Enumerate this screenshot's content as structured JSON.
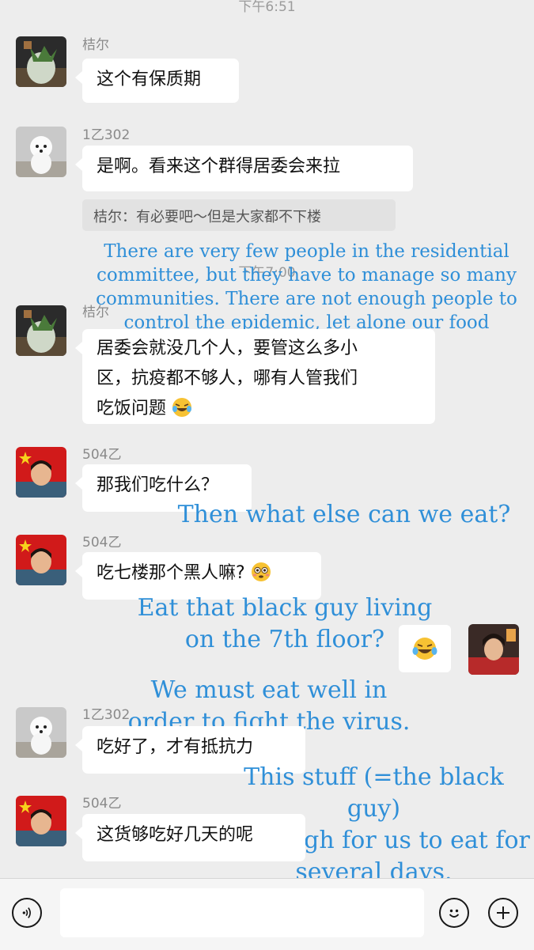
{
  "times": {
    "t1": "下午6:51",
    "t2": "下午7:00"
  },
  "messages": {
    "m1": {
      "sender": "桔尔",
      "text": "这个有保质期"
    },
    "m2": {
      "sender": "1乙302",
      "text": "是啊。看来这个群得居委会来拉",
      "quote": "桔尔：有必要吧～但是大家都不下楼"
    },
    "m3": {
      "sender": "桔尔",
      "line1": "居委会就没几个人，要管这么多小",
      "line2": "区，抗疫都不够人，哪有人管我们",
      "line3": "吃饭问题"
    },
    "m4": {
      "sender": "504乙",
      "text": "那我们吃什么？"
    },
    "m5": {
      "sender": "504乙",
      "text": "吃七楼那个黑人嘛?"
    },
    "m6": {
      "sender": "1乙302",
      "text": "吃好了，才有抵抗力"
    },
    "m7": {
      "sender": "504乙",
      "text": "这货够吃好几天的呢"
    }
  },
  "annotations": {
    "a1": {
      "line1": "There are very few people in the residential",
      "line2": "committee, but they have to manage so many",
      "line3": "communities. There are not enough people to",
      "line4": "control the epidemic, let alone our food problems."
    },
    "a2": "Then what else can we eat?",
    "a3": {
      "line1": "Eat that black guy living",
      "line2": "on the 7th floor?"
    },
    "a4": {
      "line1": "We must eat well in",
      "line2": "order to fight the virus."
    },
    "a5": {
      "line1": "This stuff (=the black guy)",
      "line2": "is enough for us to eat for",
      "line3": "several days."
    }
  },
  "icons": {
    "voice": "voice-input-icon",
    "emoji": "emoji-icon",
    "plus": "plus-icon",
    "laughing": "tears-of-joy-emoji",
    "flushed": "flushed-face-emoji"
  },
  "colors": {
    "background": "#ededed",
    "bubble": "#ffffff",
    "annotation": "#2f8fd8",
    "quote_bg": "#e2e2e2"
  }
}
